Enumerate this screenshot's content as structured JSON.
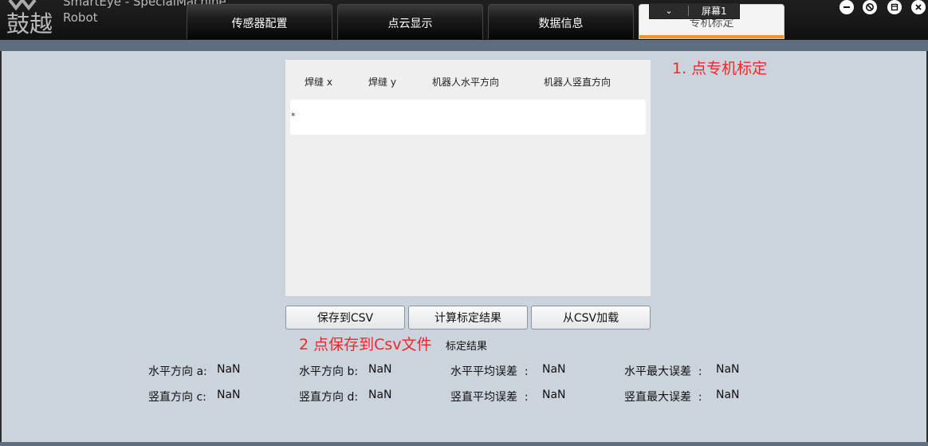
{
  "app": {
    "logo_text": "鼓越",
    "title_line1": "SmartEye - SpecialMachine",
    "title_line2": "Robot"
  },
  "tabs": [
    {
      "label": "传感器配置",
      "active": false
    },
    {
      "label": "点云显示",
      "active": false
    },
    {
      "label": "数据信息",
      "active": false
    },
    {
      "label": "专机标定",
      "active": true
    }
  ],
  "screen_select": {
    "value": "屏幕1",
    "icon": "chevron-down-icon"
  },
  "window_controls": [
    {
      "name": "minimize-icon"
    },
    {
      "name": "no-entry-icon"
    },
    {
      "name": "restore-icon"
    },
    {
      "name": "close-icon"
    }
  ],
  "grid": {
    "columns": [
      "焊缝 x",
      "焊缝 y",
      "机器人水平方向",
      "机器人竖直方向"
    ],
    "new_row_marker": "*"
  },
  "buttons": {
    "save_csv": "保存到CSV",
    "compute": "计算标定结果",
    "load_csv": "从CSV加载"
  },
  "annotations": {
    "step1": "1. 点专机标定",
    "step2": "2 点保存到Csv文件"
  },
  "results": {
    "title": "标定结果",
    "rows": [
      [
        {
          "label": "水平方向 a:",
          "value": "NaN"
        },
        {
          "label": "水平方向 b:",
          "value": "NaN"
        },
        {
          "label": "水平平均误差  :",
          "value": "NaN"
        },
        {
          "label": "水平最大误差  :",
          "value": "NaN"
        }
      ],
      [
        {
          "label": "竖直方向 c:",
          "value": "NaN"
        },
        {
          "label": "竖直方向 d:",
          "value": "NaN"
        },
        {
          "label": "竖直平均误差  :",
          "value": "NaN"
        },
        {
          "label": "竖直最大误差  :",
          "value": "NaN"
        }
      ]
    ]
  },
  "colors": {
    "accent": "#f0952a",
    "annotation": "#ea2a2a",
    "panel": "#cbd3dd"
  }
}
